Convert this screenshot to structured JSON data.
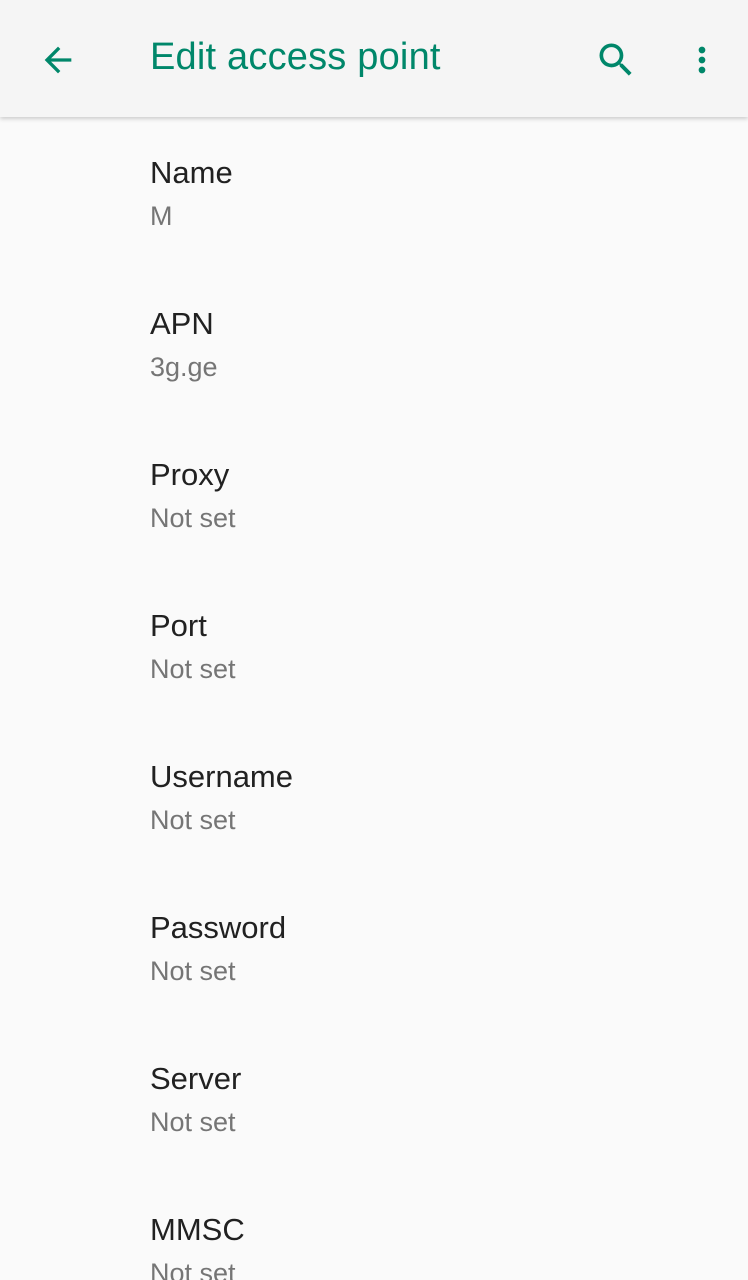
{
  "app_bar": {
    "title": "Edit access point",
    "accent_color": "#00876a",
    "icons": [
      "arrow-back-icon",
      "search-icon",
      "more-vert-icon"
    ]
  },
  "preferences": [
    {
      "label": "Name",
      "value": "M"
    },
    {
      "label": "APN",
      "value": "3g.ge"
    },
    {
      "label": "Proxy",
      "value": "Not set"
    },
    {
      "label": "Port",
      "value": "Not set"
    },
    {
      "label": "Username",
      "value": "Not set"
    },
    {
      "label": "Password",
      "value": "Not set"
    },
    {
      "label": "Server",
      "value": "Not set"
    },
    {
      "label": "MMSC",
      "value": "Not set"
    }
  ]
}
